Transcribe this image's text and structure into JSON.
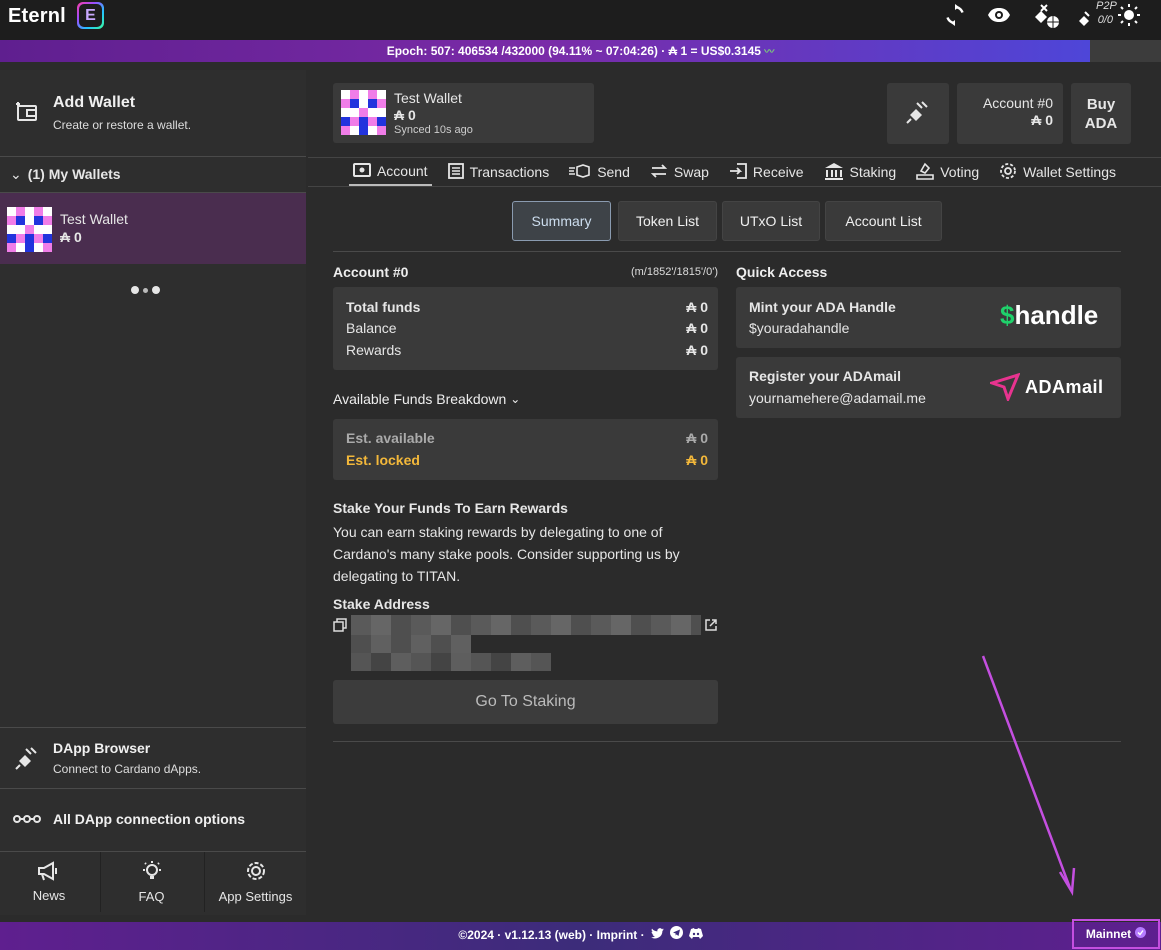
{
  "app": {
    "name": "Eternl",
    "logo_letter": "E"
  },
  "topbar": {
    "p2p_label": "P2P",
    "p2p_count": "0/0"
  },
  "epoch": {
    "text": "Epoch: 507: 406534 /432000 (94.11%  ~ 07:04:26) · ₳ 1  =  US$0.3145",
    "progress_percent": 94.11
  },
  "sidebar": {
    "add_wallet_title": "Add Wallet",
    "add_wallet_sub": "Create or restore a wallet.",
    "my_wallets_label": "(1) My Wallets",
    "wallet_name": "Test Wallet",
    "wallet_balance": "₳ 0",
    "dapp_title": "DApp Browser",
    "dapp_sub": "Connect to Cardano dApps.",
    "all_dapp": "All DApp connection options",
    "bottom": [
      {
        "label": "News",
        "icon": "megaphone-icon"
      },
      {
        "label": "FAQ",
        "icon": "lightbulb-icon"
      },
      {
        "label": "App Settings",
        "icon": "gear-icon"
      }
    ]
  },
  "header": {
    "wallet_name": "Test Wallet",
    "wallet_balance": "₳ 0",
    "synced": "Synced 10s ago",
    "account_label": "Account #0",
    "account_balance": "₳ 0",
    "buy_line1": "Buy",
    "buy_line2": "ADA"
  },
  "tabs": [
    {
      "label": "Account",
      "icon": "eye-card-icon"
    },
    {
      "label": "Transactions",
      "icon": "list-icon"
    },
    {
      "label": "Send",
      "icon": "send-icon"
    },
    {
      "label": "Swap",
      "icon": "swap-icon"
    },
    {
      "label": "Receive",
      "icon": "receive-icon"
    },
    {
      "label": "Staking",
      "icon": "bank-icon"
    },
    {
      "label": "Voting",
      "icon": "vote-icon"
    },
    {
      "label": "Wallet Settings",
      "icon": "gear-icon"
    }
  ],
  "subtabs": [
    "Summary",
    "Token List",
    "UTxO List",
    "Account List"
  ],
  "account": {
    "title": "Account #0",
    "path": "(m/1852'/1815'/0')",
    "total_label": "Total funds",
    "total_value": "₳ 0",
    "balance_label": "Balance",
    "balance_value": "₳ 0",
    "rewards_label": "Rewards",
    "rewards_value": "₳ 0",
    "breakdown_label": "Available Funds Breakdown",
    "est_available_label": "Est. available",
    "est_available_value": "₳ 0",
    "est_locked_label": "Est. locked",
    "est_locked_value": "₳ 0",
    "stake_title": "Stake Your Funds To Earn Rewards",
    "stake_text": "You can earn staking rewards by delegating to one of Cardano's many stake pools. Consider supporting us by delegating to TITAN.",
    "stake_address_title": "Stake Address",
    "go_staking": "Go To Staking"
  },
  "quick_access": {
    "title": "Quick Access",
    "handle_title": "Mint your ADA Handle",
    "handle_sub": "$youradahandle",
    "handle_logo_symbol": "$",
    "handle_logo_text": "handle",
    "mail_title": "Register your ADAmail",
    "mail_sub": "yournamehere@adamail.me",
    "mail_logo_text": "ADAmail"
  },
  "footer": {
    "text": "©2024 · v1.12.13 (web) · Imprint ·",
    "network": "Mainnet"
  },
  "colors": {
    "accent_purple": "#7a2ba8",
    "locked_yellow": "#f3b83a",
    "handle_green": "#1fd26b",
    "adamail_pink": "#e8338f",
    "annotation": "#c44fe0"
  }
}
